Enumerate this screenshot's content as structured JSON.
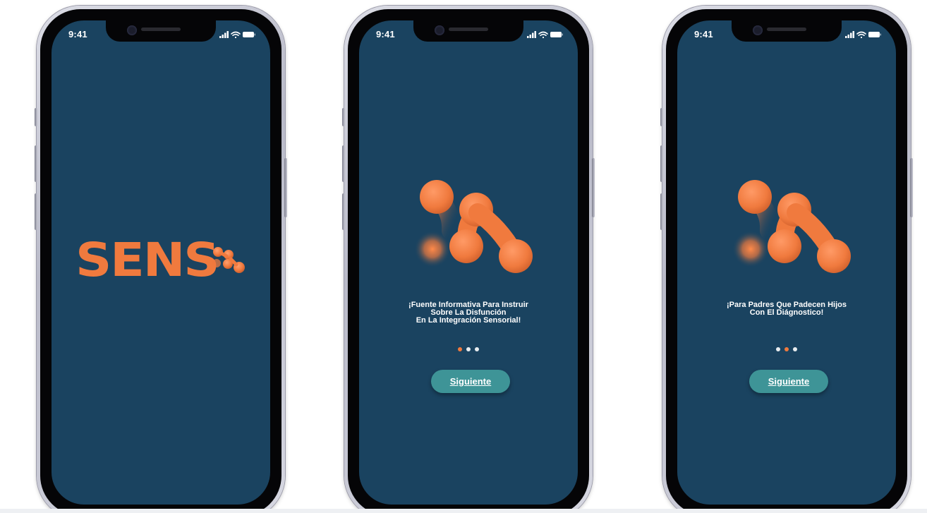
{
  "colors": {
    "screen_bg": "#1a4360",
    "brand_orange": "#f07a3e",
    "button_teal": "#3e9497",
    "dot_inactive": "#e8ecef"
  },
  "status_bar": {
    "time": "9:41",
    "icons": [
      "signal-icon",
      "wifi-icon",
      "battery-icon"
    ]
  },
  "screens": [
    {
      "id": "splash",
      "logo_text": "SENS"
    },
    {
      "id": "onboarding-1",
      "message": "¡Fuente Informativa Para Instruir\nSobre La Disfunción\nEn La Integración Sensorial!",
      "active_dot": 1,
      "dot_count": 3,
      "button_label": "Siguiente"
    },
    {
      "id": "onboarding-2",
      "message": "¡Para Padres Que Padecen Hijos\nCon El Diágnostico!",
      "active_dot": 2,
      "dot_count": 3,
      "button_label": "Siguiente"
    }
  ]
}
